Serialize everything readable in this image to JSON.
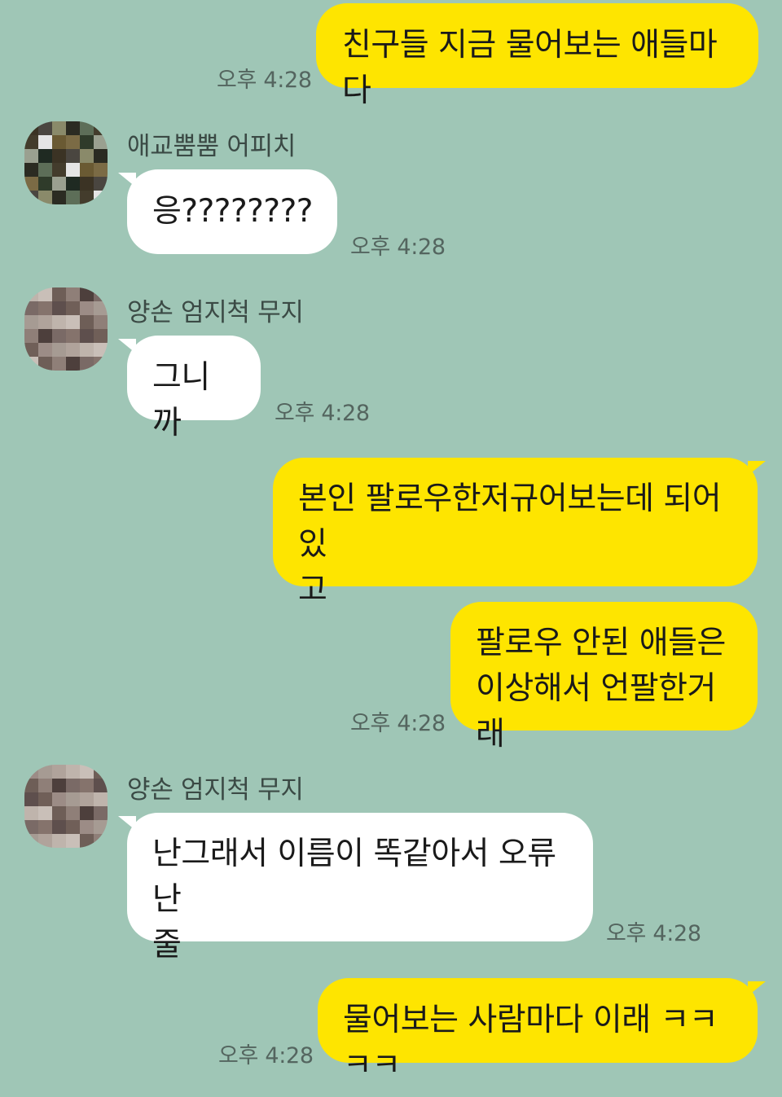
{
  "messages": [
    {
      "side": "mine",
      "text": "친구들 지금 물어보는 애들마다",
      "time": "오후 4:28"
    },
    {
      "side": "theirs",
      "sender": "애교뿜뿜 어피치",
      "text": "응????????",
      "time": "오후 4:28"
    },
    {
      "side": "theirs",
      "sender": "양손 엄지척 무지",
      "text": "그니까",
      "time": "오후 4:28"
    },
    {
      "side": "mine",
      "text_line1": "본인 팔로우한저규어보는데 되어있",
      "text_line2": "고"
    },
    {
      "side": "mine",
      "text_line1": "팔로우 안된 애들은",
      "text_line2": "이상해서 언팔한거래",
      "time": "오후 4:28"
    },
    {
      "side": "theirs",
      "sender": "양손 엄지척 무지",
      "text_line1": "난그래서 이름이 똑같아서 오류난",
      "text_line2": "줄",
      "time": "오후 4:28"
    },
    {
      "side": "mine",
      "text": "물어보는 사람마다 이래 ㅋㅋㅋㅋ",
      "time": "오후 4:28"
    }
  ],
  "avatars": [
    {
      "description": "pixelated-profile-image",
      "palette": [
        "#3b3324",
        "#6a5a33",
        "#8a8a6a",
        "#2f3b2a",
        "#5d6e58",
        "#1f2a22",
        "#e5e5e5",
        "#4a4640",
        "#7b6b45",
        "#2b2b22",
        "#9aa090",
        "#433c2c"
      ]
    },
    {
      "description": "pixelated-profile-image",
      "palette": [
        "#8f7f78",
        "#a69b93",
        "#7a6a66",
        "#bfb4ac",
        "#5e4f4d",
        "#6e5e57",
        "#9c8c86",
        "#4d3f3c",
        "#b0a39b",
        "#85736c",
        "#c9bfb8",
        "#705f58"
      ]
    },
    {
      "description": "pixelated-profile-image",
      "palette": [
        "#8f7f78",
        "#a69b93",
        "#7a6a66",
        "#bfb4ac",
        "#5e4f4d",
        "#6e5e57",
        "#9c8c86",
        "#4d3f3c",
        "#b0a39b",
        "#85736c",
        "#c9bfb8",
        "#705f58"
      ]
    }
  ],
  "colors": {
    "background": "#9fc6b6",
    "my_bubble": "#fee500",
    "their_bubble": "#ffffff"
  }
}
